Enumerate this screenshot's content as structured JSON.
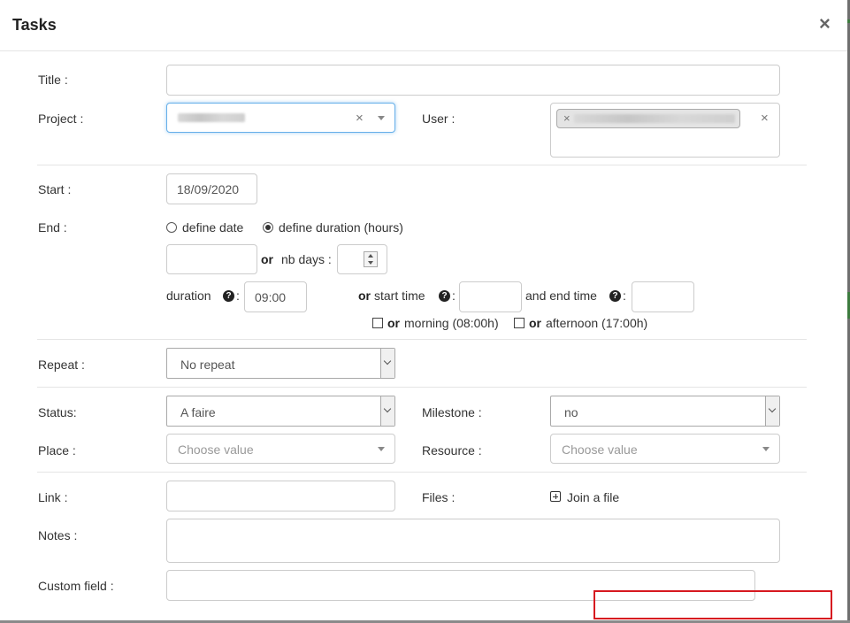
{
  "modal": {
    "title": "Tasks",
    "close": "×"
  },
  "form": {
    "title_label": "Title :",
    "project_label": "Project :",
    "user_label": "User :",
    "start_label": "Start :",
    "start_value": "18/09/2020",
    "end_label": "End :",
    "define_date": "define date",
    "define_duration": "define duration (hours)",
    "or": "or",
    "nb_days": "nb days :",
    "duration": "duration",
    "colon": ":",
    "duration_value": "09:00",
    "start_time": "start time",
    "and_end_time": "and end time",
    "morning": "morning (08:00h)",
    "afternoon": "afternoon (17:00h)",
    "repeat_label": "Repeat :",
    "repeat_value": "No repeat",
    "status_label": "Status:",
    "status_value": "A faire",
    "milestone_label": "Milestone :",
    "milestone_value": "no",
    "place_label": "Place :",
    "place_placeholder": "Choose value",
    "resource_label": "Resource :",
    "resource_placeholder": "Choose value",
    "link_label": "Link :",
    "files_label": "Files :",
    "join_file": "Join a file",
    "notes_label": "Notes :",
    "custom_field_label": "Custom field :"
  },
  "icons": {
    "help": "?",
    "clear": "×"
  },
  "colors": {
    "focus_border": "#66afe9",
    "annotation_red": "#d71920"
  }
}
